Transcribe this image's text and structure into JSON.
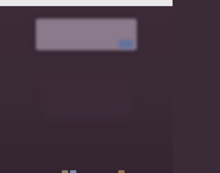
{
  "screen": {
    "background_color": "#3b2a37",
    "top_bar_color": "#e9e9e9"
  },
  "dialog": {
    "color": "#8b7a8b",
    "accent_color": "#5a6fa3"
  },
  "taskbar": {
    "icons": [
      {
        "name": "app-icon-1",
        "color": "#8a7f68"
      },
      {
        "name": "app-icon-2",
        "color": "#7c8aa5"
      },
      {
        "name": "app-icon-3",
        "color": "#9a6f52"
      }
    ]
  }
}
